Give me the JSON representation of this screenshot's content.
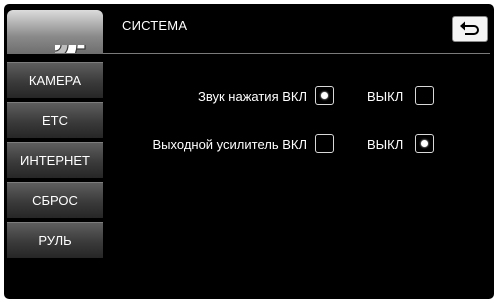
{
  "header": {
    "title": "СИСТЕМА",
    "settings_icon": "gear-icon",
    "back_icon": "back-arrow-icon"
  },
  "sidebar": {
    "items": [
      {
        "label": "КАМЕРА"
      },
      {
        "label": "ETC"
      },
      {
        "label": "ИНТЕРНЕТ"
      },
      {
        "label": "СБРОС"
      },
      {
        "label": "РУЛЬ"
      }
    ]
  },
  "settings": {
    "rows": [
      {
        "label": "Звук нажатия ВКЛ",
        "off_label": "ВЫКЛ",
        "on_selected": true,
        "off_selected": false
      },
      {
        "label": "Выходной усилитель ВКЛ",
        "off_label": "ВЫКЛ",
        "on_selected": false,
        "off_selected": true
      }
    ]
  },
  "colors": {
    "background": "#000000",
    "text": "#ffffff",
    "checkbox_border": "#d9d9d9"
  }
}
